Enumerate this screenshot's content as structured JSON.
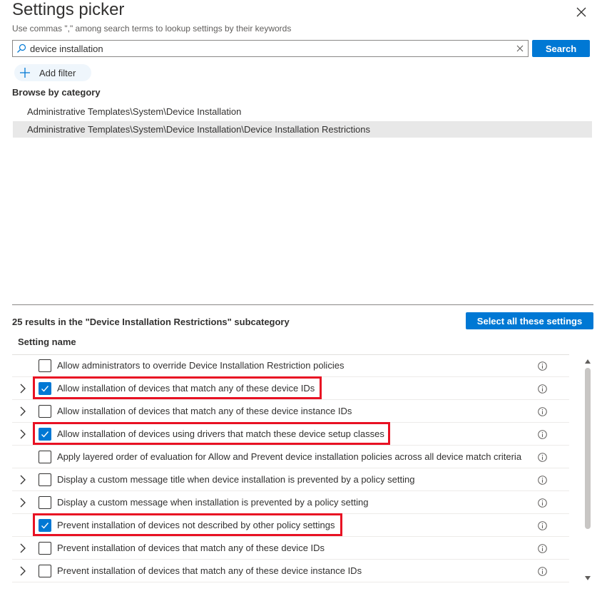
{
  "header": {
    "title": "Settings picker",
    "subtitle": "Use commas \",\" among search terms to lookup settings by their keywords"
  },
  "search": {
    "value": "device installation",
    "button_label": "Search"
  },
  "filter": {
    "add_label": "Add filter"
  },
  "browse": {
    "heading": "Browse by category",
    "categories": [
      {
        "label": "Administrative Templates\\System\\Device Installation",
        "selected": false
      },
      {
        "label": "Administrative Templates\\System\\Device Installation\\Device Installation Restrictions",
        "selected": true
      }
    ]
  },
  "results": {
    "summary": "25 results in the \"Device Installation Restrictions\" subcategory",
    "select_all_label": "Select all these settings",
    "column_header": "Setting name",
    "settings": [
      {
        "label": "Allow administrators to override Device Installation Restriction policies",
        "checked": false,
        "expandable": false,
        "highlighted": false
      },
      {
        "label": "Allow installation of devices that match any of these device IDs",
        "checked": true,
        "expandable": true,
        "highlighted": true
      },
      {
        "label": "Allow installation of devices that match any of these device instance IDs",
        "checked": false,
        "expandable": true,
        "highlighted": false
      },
      {
        "label": "Allow installation of devices using drivers that match these device setup classes",
        "checked": true,
        "expandable": true,
        "highlighted": true
      },
      {
        "label": "Apply layered order of evaluation for Allow and Prevent device installation policies across all device match criteria",
        "checked": false,
        "expandable": false,
        "highlighted": false
      },
      {
        "label": "Display a custom message title when device installation is prevented by a policy setting",
        "checked": false,
        "expandable": true,
        "highlighted": false
      },
      {
        "label": "Display a custom message when installation is prevented by a policy setting",
        "checked": false,
        "expandable": true,
        "highlighted": false
      },
      {
        "label": "Prevent installation of devices not described by other policy settings",
        "checked": true,
        "expandable": false,
        "highlighted": true
      },
      {
        "label": "Prevent installation of devices that match any of these device IDs",
        "checked": false,
        "expandable": true,
        "highlighted": false
      },
      {
        "label": "Prevent installation of devices that match any of these device instance IDs",
        "checked": false,
        "expandable": true,
        "highlighted": false
      }
    ]
  },
  "icons": {
    "close": "close-icon",
    "search": "search-icon",
    "clear": "clear-icon",
    "add": "plus-icon",
    "expand": "chevron-right-icon",
    "info": "info-icon",
    "check": "checkmark-icon"
  },
  "colors": {
    "accent": "#0078d4",
    "highlight_border": "#e81123",
    "selected_row": "#e8e8e8"
  }
}
